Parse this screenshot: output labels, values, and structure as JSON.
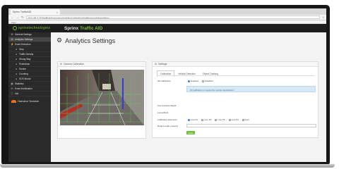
{
  "browser": {
    "tab_title": "Sprinx TrafficAID",
    "tab_close": "×",
    "address": "192.168.2.187/trafficaid/app/setup/analytics/calibration#/settings/analyticssettings",
    "bookmarks": "Apps",
    "back_glyph": "←",
    "forward_glyph": "→",
    "reload_glyph": "↻",
    "menu_glyph": "≡"
  },
  "header": {
    "logo_text": "sprinxtechnologies",
    "title_prefix": "Sprinx",
    "title_accent": "Traffic AID"
  },
  "sidebar": {
    "items": [
      {
        "label": "General Settings",
        "icon": "gear-icon",
        "glyph": "⚙"
      },
      {
        "label": "Analytics Settings",
        "icon": "chart-icon",
        "glyph": "▤"
      },
      {
        "label": "Event Detection",
        "icon": "bolt-icon",
        "glyph": "⚡"
      },
      {
        "label": "Stop",
        "icon": "stop-icon",
        "glyph": "●"
      },
      {
        "label": "Traffic Density",
        "icon": "density-icon",
        "glyph": "●"
      },
      {
        "label": "Wrong Way",
        "icon": "wrong-way-icon",
        "glyph": "●"
      },
      {
        "label": "Pedestrian",
        "icon": "pedestrian-icon",
        "glyph": "●"
      },
      {
        "label": "Smoke",
        "icon": "smoke-icon",
        "glyph": "●"
      },
      {
        "label": "Counting",
        "icon": "counting-icon",
        "glyph": "●"
      },
      {
        "label": "SOS Modul",
        "icon": "sos-icon",
        "glyph": "●"
      },
      {
        "label": "Statistics",
        "icon": "statistics-icon",
        "glyph": "▦"
      },
      {
        "label": "Event Notification",
        "icon": "bell-icon",
        "glyph": "✉"
      },
      {
        "label": "Info",
        "icon": "info-icon",
        "glyph": "ⓘ"
      }
    ],
    "hanwha_text": "Hanwha Techwin"
  },
  "page": {
    "title": "Analytics Settings",
    "title_icon": "gears-icon"
  },
  "camera_panel": {
    "title": "Camera Calibration"
  },
  "settings_panel": {
    "title": "Settings",
    "tabs": [
      "Calibration",
      "Vehicle Detection",
      "Object Tracking"
    ],
    "calibration_label": "3D Calibration",
    "enabled_label": "Enabled",
    "disabled_label": "Disabled",
    "calibration_state": "Enabled",
    "info_text": "3D Calibration is required for vehicle classification!",
    "height_label": "Use Camera Height",
    "height_value": "",
    "lanes_label": "Lanes/Refs",
    "lanes_value": "",
    "elements_label": "Calibration Elements",
    "elements": [
      "Line P1",
      "Line P2",
      "Line P3",
      "Line P4",
      "Grid"
    ],
    "selected_element": "Line P1",
    "road_length_label": "Road Length (meters)",
    "road_length_value": "",
    "apply_label": "Apply"
  },
  "colors": {
    "brand_green": "#7cc443",
    "sidebar_bg": "#2a2a2a",
    "info_bg": "#d7e9f7",
    "apply_green": "#6dbf3d"
  }
}
